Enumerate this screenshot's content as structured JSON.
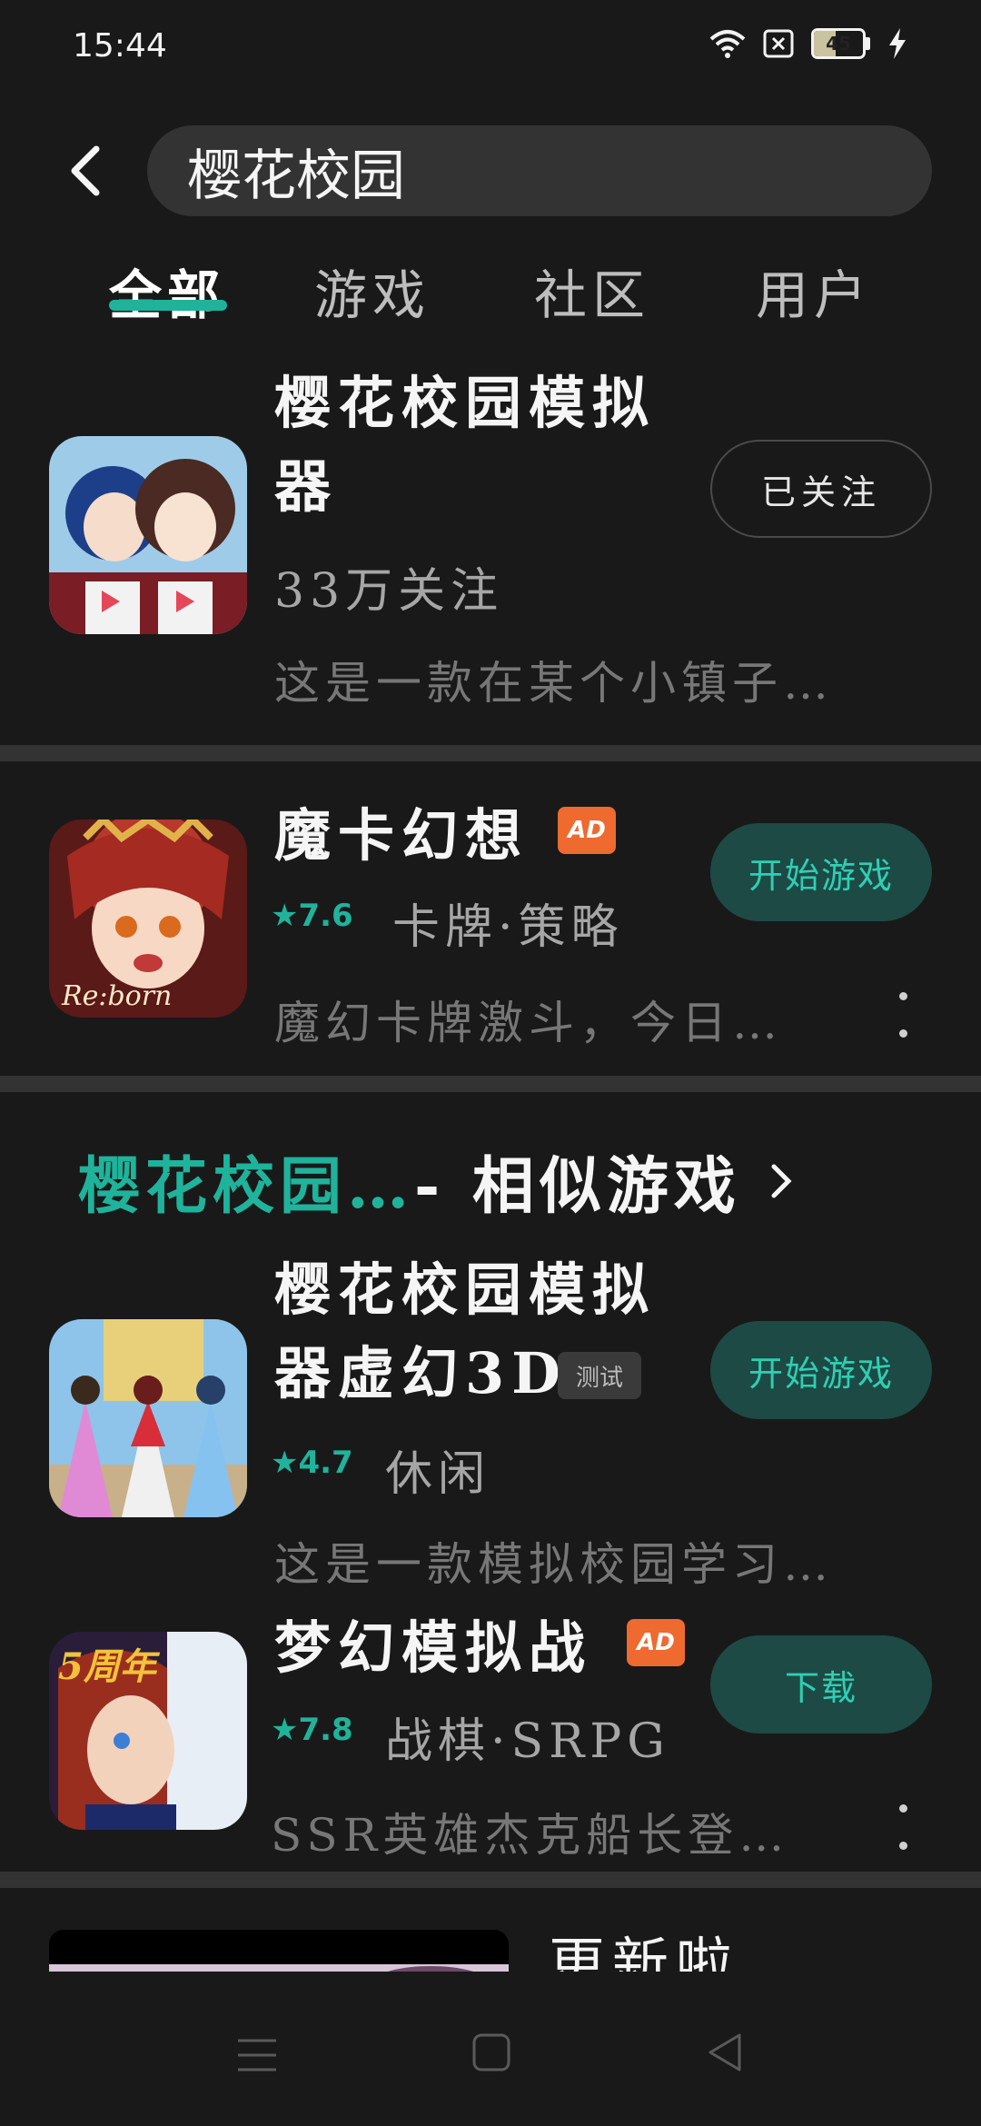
{
  "status": {
    "time": "15:44",
    "battery": "45",
    "battery_level": 0.45
  },
  "search": {
    "query": "樱花校园"
  },
  "tabs": [
    {
      "label": "全部",
      "active": true
    },
    {
      "label": "游戏",
      "active": false
    },
    {
      "label": "社区",
      "active": false
    },
    {
      "label": "用户",
      "active": false
    }
  ],
  "results": {
    "topic": {
      "title_line1": "樱花校园模拟",
      "title_line2": "器",
      "followers": "33万关注",
      "desc": "这是一款在某个小镇子…",
      "button": "已关注"
    },
    "ad_game": {
      "title": "魔卡幻想",
      "badge": "AD",
      "rating": "7.6",
      "tags": "卡牌·策略",
      "desc": "魔幻卡牌激斗，今日…",
      "button": "开始游戏",
      "icon_text": "Re:born"
    }
  },
  "similar": {
    "heading_accent": "樱花校园…",
    "heading_rest": " - 相似游戏",
    "items": [
      {
        "title_line1": "樱花校园模拟",
        "title_line2": "器虚幻3D",
        "badge": "测试",
        "rating": "4.7",
        "tags": "休闲",
        "desc": "这是一款模拟校园学习…",
        "button": "开始游戏"
      },
      {
        "title": "梦幻模拟战",
        "badge": "AD",
        "rating": "7.8",
        "tags": "战棋·SRPG",
        "desc": "SSR英雄杰克船长登…",
        "button": "下载",
        "icon_text": "5周年"
      }
    ]
  },
  "bottom_card": {
    "title": "更新啦"
  },
  "colors": {
    "accent": "#1fb39c",
    "background": "#191919",
    "ad_badge": "#ee6a2f"
  }
}
